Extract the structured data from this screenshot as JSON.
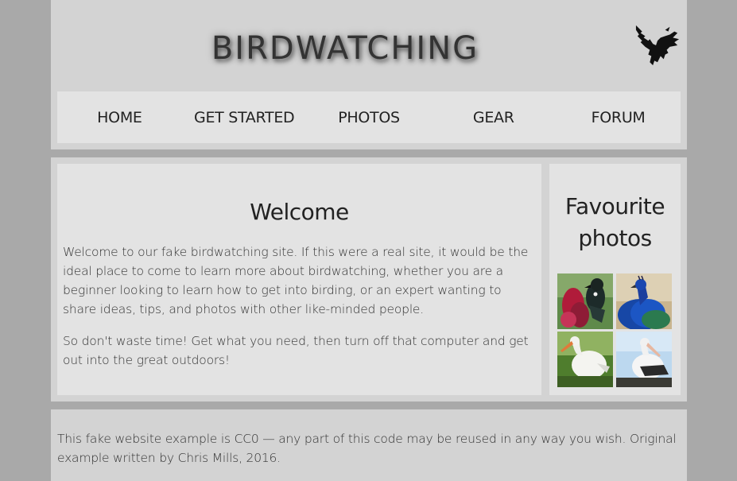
{
  "header": {
    "title": "BIRDWATCHING",
    "logo_icon": "bird-silhouette-icon"
  },
  "nav": {
    "items": [
      {
        "label": "HOME"
      },
      {
        "label": "GET STARTED"
      },
      {
        "label": "PHOTOS"
      },
      {
        "label": "GEAR"
      },
      {
        "label": "FORUM"
      }
    ]
  },
  "article": {
    "heading": "Welcome",
    "paragraphs": [
      "Welcome to our fake birdwatching site. If this were a real site, it would be the ideal place to come to learn more about birdwatching, whether you are a beginner looking to learn how to get into birding, or an expert wanting to share ideas, tips, and photos with other like-minded people.",
      "So don't waste time! Get what you need, then turn off that computer and get out into the great outdoors!"
    ]
  },
  "aside": {
    "heading": "Favourite photos",
    "photos": [
      {
        "icon": "tui-bird-photo"
      },
      {
        "icon": "peacock-photo"
      },
      {
        "icon": "stork-photo"
      },
      {
        "icon": "pelican-photo"
      }
    ]
  },
  "footer": {
    "text": "This fake website example is CC0 — any part of this code may be reused in any way you wish. Original example written by Chris Mills, 2016."
  },
  "colors": {
    "background": "#a9a9a9",
    "panel": "#d3d3d3",
    "inner_panel": "#e3e3e3"
  }
}
